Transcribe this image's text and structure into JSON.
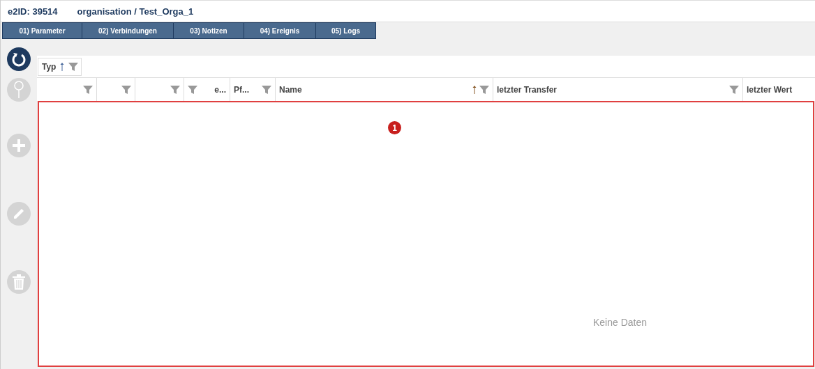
{
  "header": {
    "id_label": "e2ID:",
    "id_value": "39514",
    "path": "organisation / Test_Orga_1"
  },
  "tabs": [
    {
      "label": "01) Parameter",
      "selected": false
    },
    {
      "label": "02) Verbindungen",
      "selected": false
    },
    {
      "label": "03) Notizen",
      "selected": false
    },
    {
      "label": "04) Ereignis",
      "selected": false
    },
    {
      "label": "05) Logs",
      "selected": false
    }
  ],
  "side_buttons": [
    {
      "kind": "refresh",
      "disabled": false
    },
    {
      "kind": "pin",
      "disabled": true
    },
    {
      "kind": "add",
      "disabled": true
    },
    {
      "kind": "edit",
      "disabled": true
    },
    {
      "kind": "delete",
      "disabled": true
    }
  ],
  "group_panel": {
    "label": "Typ",
    "sorted": true
  },
  "table": {
    "columns": [
      {
        "kind": "trailing-filter",
        "sorted": false
      },
      {
        "kind": "trailing-filter",
        "sorted": false
      },
      {
        "kind": "trailing-filter",
        "sorted": false
      },
      {
        "label": "e...",
        "kind": "leading-filter",
        "sorted": false
      },
      {
        "label": "Pf...",
        "kind": "trailing-filter",
        "sorted": false
      },
      {
        "label": "Name",
        "kind": "trailing-filter",
        "sorted": true
      },
      {
        "label": "letzter Transfer",
        "kind": "trailing-filter",
        "sorted": false
      },
      {
        "label": "letzter Wert",
        "kind": "plain",
        "sorted": false
      }
    ],
    "empty_text": "Keine Daten"
  },
  "annotation": {
    "label": "1"
  }
}
